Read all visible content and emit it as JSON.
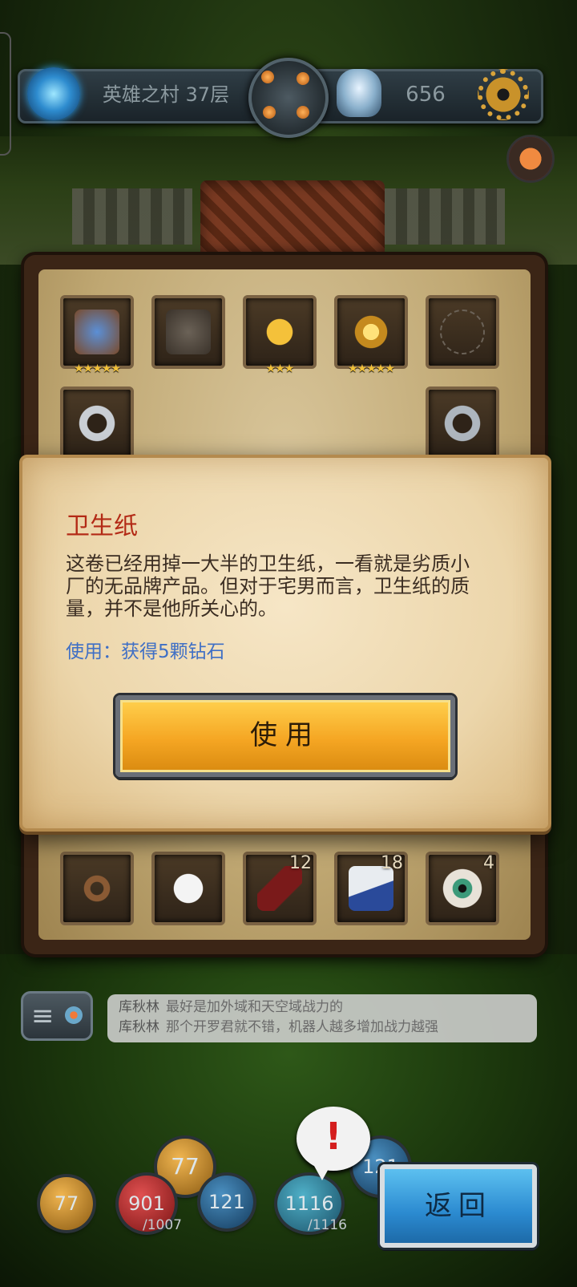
{
  "header": {
    "level_label": "英雄之村 37层",
    "score": "656"
  },
  "bag": {
    "row1": [
      {
        "icon": "bracer-icon",
        "stars": "★★★★★"
      },
      {
        "icon": "armor-silhouette-icon",
        "stars": ""
      },
      {
        "icon": "golden-wings-icon",
        "stars": "★★★"
      },
      {
        "icon": "lantern-icon",
        "stars": "★★★★★"
      },
      {
        "icon": "necklace-silhouette-icon",
        "stars": ""
      }
    ],
    "row2": [
      {
        "icon": "silver-bracelet-icon",
        "stars": "★"
      },
      {
        "icon": "silver-ring-icon",
        "stars": "★★"
      }
    ],
    "row_bottom": [
      {
        "icon": "whip-icon",
        "count": ""
      },
      {
        "icon": "toilet-paper-icon",
        "count": ""
      },
      {
        "icon": "wine-bottle-icon",
        "count": "12"
      },
      {
        "icon": "cigarette-pack-icon",
        "count": "18"
      },
      {
        "icon": "eyeball-icon",
        "count": "4"
      }
    ]
  },
  "modal": {
    "title": "卫生纸",
    "description": "这卷已经用掉一大半的卫生纸，一看就是劣质小厂的无品牌产品。但对于宅男而言，卫生纸的质量，并不是他所关心的。",
    "use_effect": "使用：获得5颗钻石",
    "use_button": "使用"
  },
  "chat": {
    "lines": [
      {
        "speaker": "库秋林",
        "text": "最好是加外域和天空域战力的"
      },
      {
        "speaker": "库秋林",
        "text": "那个开罗君就不错，机器人越多增加战力越强"
      }
    ]
  },
  "hud": {
    "orb1": "77",
    "orb1_top": "77",
    "orb2": "901",
    "orb2_sub": "/1007",
    "orb3": "121",
    "orb3_top": "121",
    "orb4": "1116",
    "orb4_sub": "/1116",
    "alert": "!",
    "return_button": "返回"
  },
  "colors": {
    "title_red": "#b32a16",
    "use_effect_blue": "#3f6fc5",
    "button_orange": "#f5a623",
    "button_blue": "#2b8ad0"
  }
}
